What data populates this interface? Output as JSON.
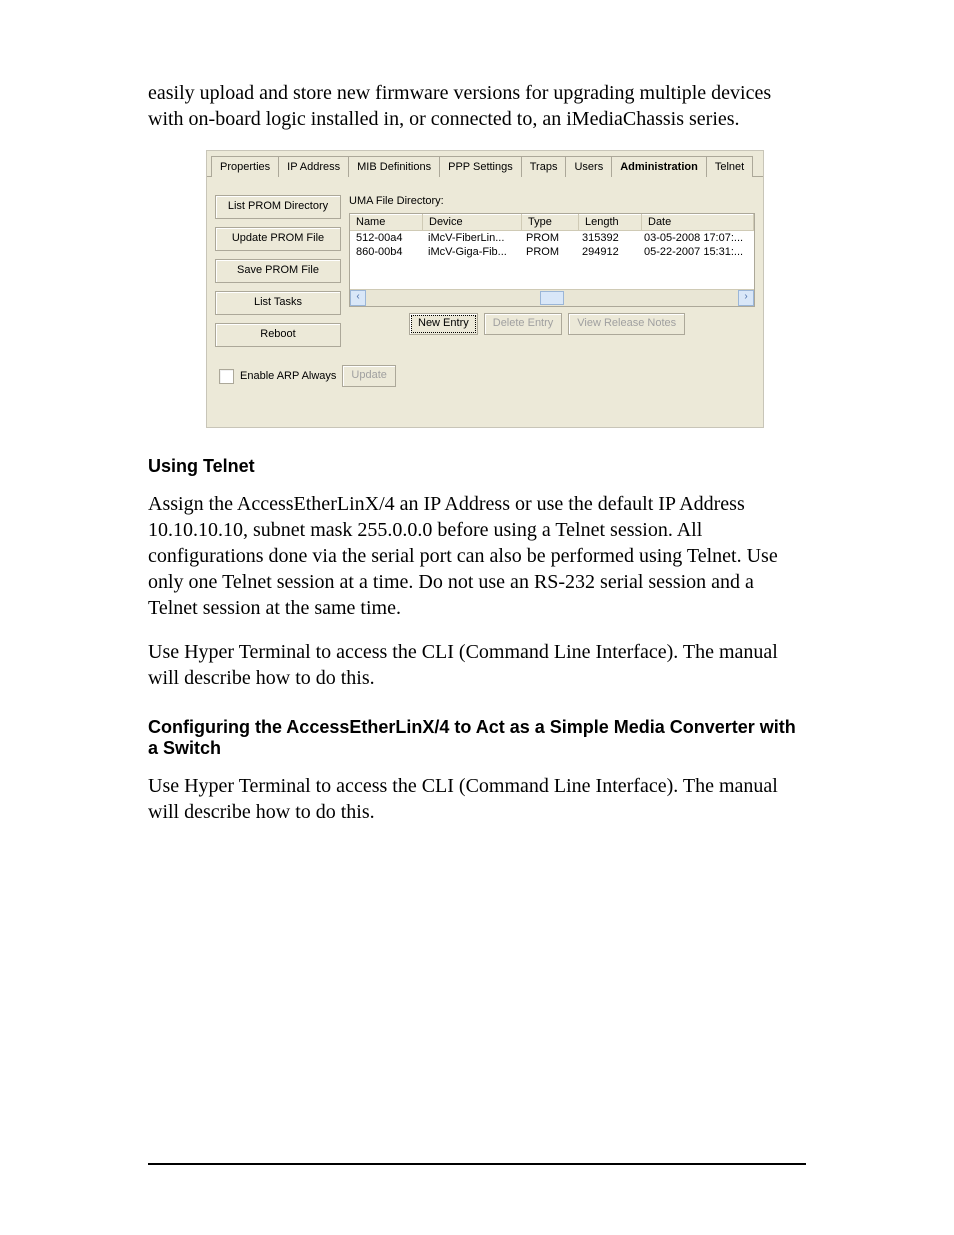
{
  "intro_para": "easily upload and store new firmware versions for upgrading multiple devices with on-board logic installed in, or connected to, an iMediaChassis series.",
  "screenshot": {
    "tabs": [
      "Properties",
      "IP Address",
      "MIB Definitions",
      "PPP Settings",
      "Traps",
      "Users",
      "Administration",
      "Telnet"
    ],
    "active_tab": "Administration",
    "left_buttons": {
      "list_prom_dir": "List PROM Directory",
      "update_prom": "Update PROM File",
      "save_prom": "Save PROM File",
      "list_tasks": "List Tasks",
      "reboot": "Reboot"
    },
    "uma_label": "UMA File Directory:",
    "columns": {
      "name": "Name",
      "device": "Device",
      "type": "Type",
      "length": "Length",
      "date": "Date"
    },
    "rows": [
      {
        "name": "512-00a4",
        "device": "iMcV-FiberLin...",
        "type": "PROM",
        "length": "315392",
        "date": "03-05-2008 17:07:..."
      },
      {
        "name": "860-00b4",
        "device": "iMcV-Giga-Fib...",
        "type": "PROM",
        "length": "294912",
        "date": "05-22-2007 15:31:..."
      }
    ],
    "actions": {
      "new_entry": "New Entry",
      "delete_entry": "Delete Entry",
      "view_notes": "View Release Notes"
    },
    "enable_arp_label": "Enable ARP Always",
    "update_btn": "Update"
  },
  "telnet_heading": "Using Telnet",
  "telnet_p1": "Assign the AccessEtherLinX/4 an IP Address or use the default IP Address 10.10.10.10, subnet mask 255.0.0.0 before using a Telnet session.  All configurations done via the serial port can also be performed using Telnet.  Use only one Telnet session at a time.  Do not use an RS-232 serial session and a Telnet session at the same time.",
  "telnet_p2": "Use Hyper Terminal to access the CLI (Command Line Interface).  The manual will describe how to do this.",
  "config_heading": "Configuring the AccessEtherLinX/4 to Act as a Simple Media Converter with a Switch",
  "config_p1": "Use Hyper Terminal to access the CLI (Command Line Interface).  The manual will describe how to do this."
}
